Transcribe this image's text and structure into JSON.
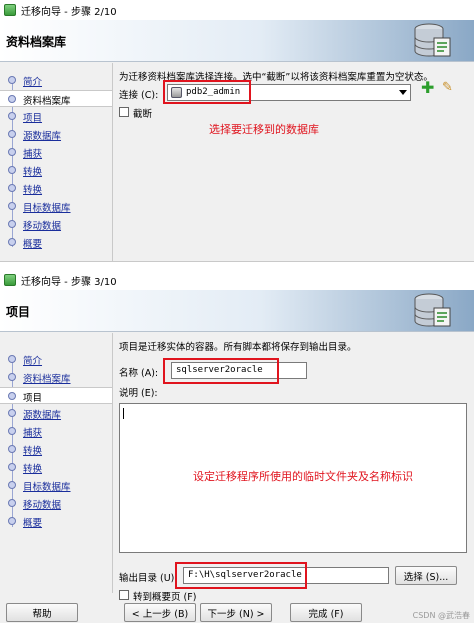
{
  "window1": {
    "title": "迁移向导 - 步骤 2/10",
    "header_title": "资料档案库",
    "nav": [
      "简介",
      "资料档案库",
      "项目",
      "源数据库",
      "捕获",
      "转换",
      "转换",
      "目标数据库",
      "移动数据",
      "概要"
    ],
    "description": "为迁移资料档案库选择连接。选中“截断”以将该资料档案库重置为空状态。",
    "connection_label": "连接 (C):",
    "connection_value": "pdb2_admin",
    "truncate_label": "截断",
    "annotation": "选择要迁移到的数据库"
  },
  "window2": {
    "title": "迁移向导 - 步骤 3/10",
    "header_title": "项目",
    "nav": [
      "简介",
      "资料档案库",
      "项目",
      "源数据库",
      "捕获",
      "转换",
      "转换",
      "目标数据库",
      "移动数据",
      "概要"
    ],
    "description": "项目是迁移实体的容器。所有脚本都将保存到输出目录。",
    "name_label": "名称 (A):",
    "name_value": "sqlserver2oracle",
    "desc_label": "说明 (E):",
    "annotation": "设定迁移程序所使用的临时文件夹及名称标识",
    "output_label": "输出目录 (U):",
    "output_value": "F:\\H\\sqlserver2oracle",
    "browse_label": "选择 (S)...",
    "skip_label": "转到概要页 (F)",
    "buttons": {
      "help": "帮助",
      "back": "< 上一步 (B)",
      "next": "下一步 (N) >",
      "finish": "完成 (F)"
    },
    "watermark": "CSDN @武浩春"
  },
  "colors": {
    "annotation_red": "#e0141e",
    "nav_link": "#1a2e9c"
  }
}
